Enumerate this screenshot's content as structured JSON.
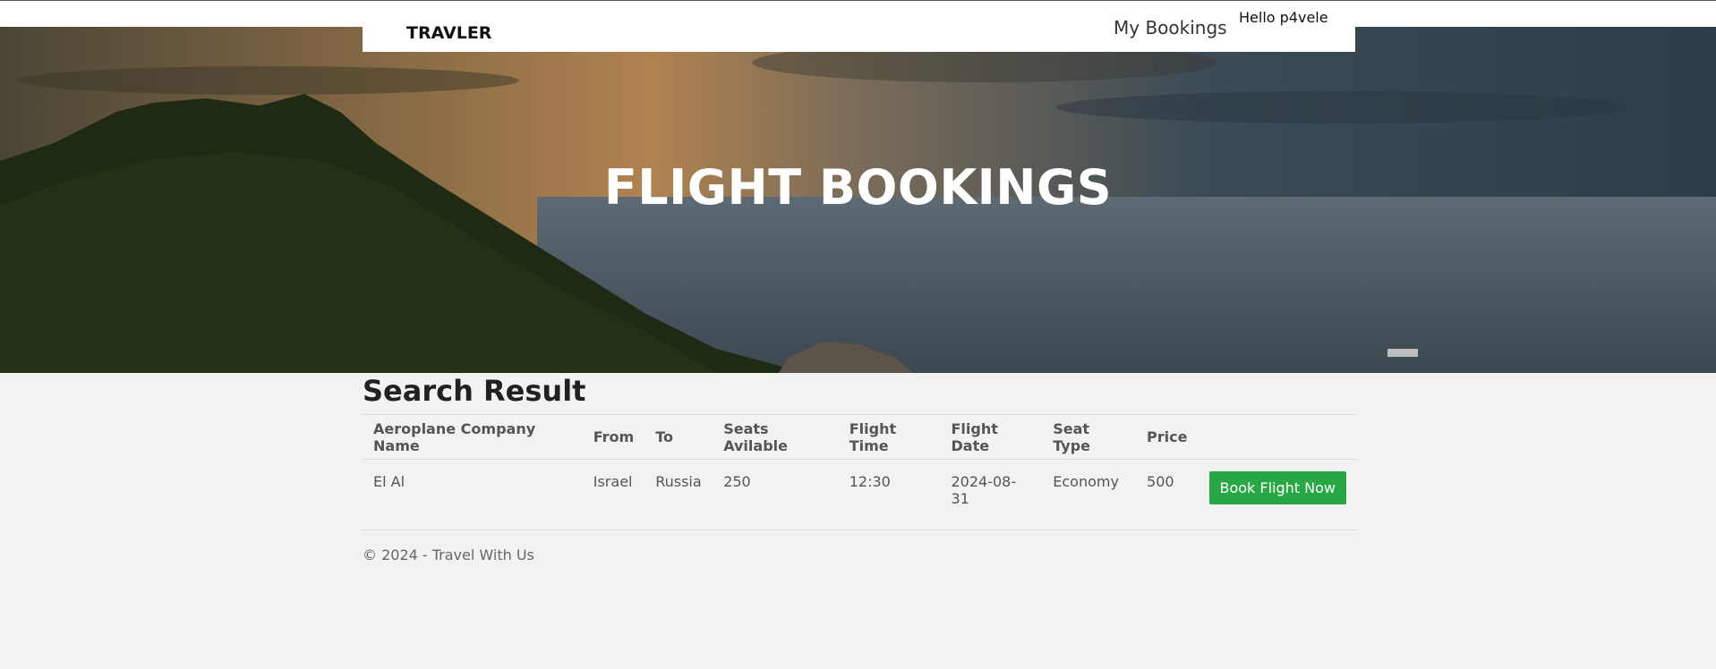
{
  "navbar": {
    "brand": "TRAVLER",
    "my_bookings_label": "My Bookings",
    "greeting": "Hello p4vele"
  },
  "hero": {
    "title": "FLIGHT BOOKINGS"
  },
  "results": {
    "title": "Search Result",
    "columns": [
      "Aeroplane Company Name",
      "From",
      "To",
      "Seats Avilable",
      "Flight Time",
      "Flight Date",
      "Seat Type",
      "Price"
    ],
    "rows": [
      {
        "company": "El Al",
        "from": "Israel",
        "to": "Russia",
        "seats": "250",
        "time": "12:30",
        "date": "2024-08-31",
        "seat_type": "Economy",
        "price": "500",
        "action_label": "Book Flight Now"
      }
    ]
  },
  "footer": {
    "text": "© 2024 - Travel With Us"
  },
  "colors": {
    "accent_green": "#28a745",
    "page_background": "#f2f2f2"
  }
}
